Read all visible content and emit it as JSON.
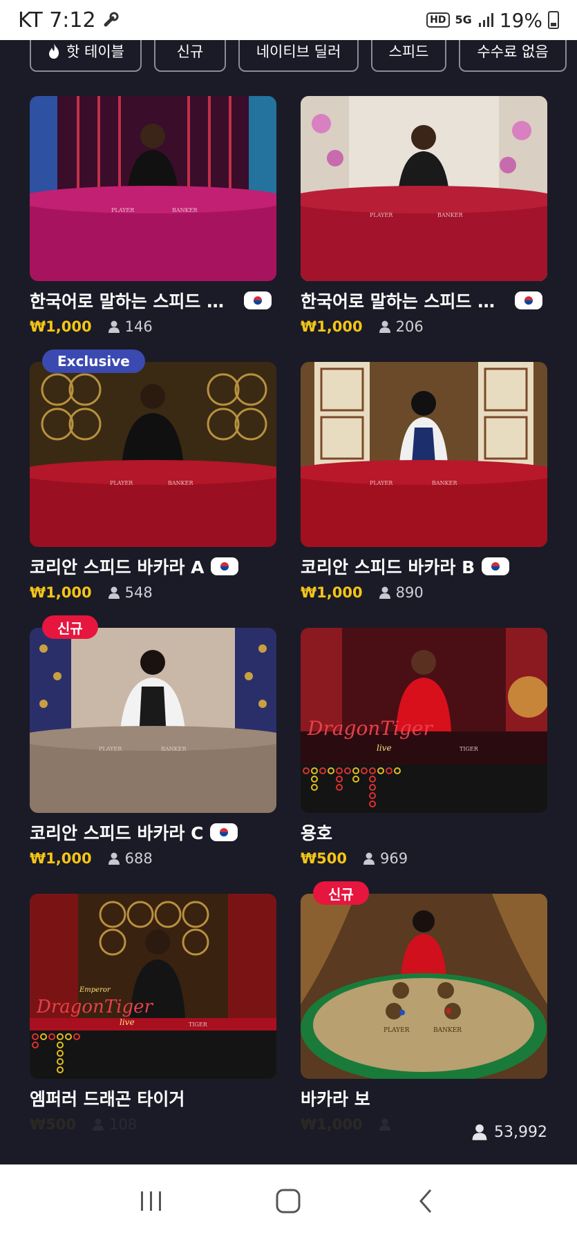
{
  "status": {
    "carrier_time": "KT 7:12",
    "battery": "19%",
    "hd_badge": "HD",
    "network": "5G",
    "icons": [
      "wrench-icon",
      "hd-icon",
      "5g-icon",
      "signal-icon",
      "battery-icon"
    ]
  },
  "filters": [
    {
      "label": "핫 테이블",
      "icon": "flame-icon"
    },
    {
      "label": "신규"
    },
    {
      "label": "네이티브 딜러"
    },
    {
      "label": "스피드"
    },
    {
      "label": "수수료 없음"
    }
  ],
  "games": [
    {
      "title": "한국어로 말하는 스피드 바...",
      "price": "₩1,000",
      "players": "146",
      "flag": "kr-flag",
      "badge": ""
    },
    {
      "title": "한국어로 말하는 스피드 바...",
      "price": "₩1,000",
      "players": "206",
      "flag": "kr-flag",
      "badge": ""
    },
    {
      "title": "코리안 스피드 바카라 A",
      "price": "₩1,000",
      "players": "548",
      "flag": "kr-flag",
      "badge": "Exclusive"
    },
    {
      "title": "코리안 스피드 바카라 B",
      "price": "₩1,000",
      "players": "890",
      "flag": "kr-flag",
      "badge": ""
    },
    {
      "title": "코리안 스피드 바카라 C",
      "price": "₩1,000",
      "players": "688",
      "flag": "kr-flag",
      "badge": "신규"
    },
    {
      "title": "용호",
      "price": "₩500",
      "players": "969",
      "flag": "",
      "badge": ""
    },
    {
      "title": "엠퍼러 드래곤 타이거",
      "price": "₩500",
      "players": "108",
      "flag": "",
      "badge": ""
    },
    {
      "title": "바카라 보",
      "price": "₩1,000",
      "players": "",
      "flag": "",
      "badge": "신규"
    }
  ],
  "thumb_text": {
    "player": "PLAYER",
    "banker": "BANKER",
    "tiger": "TIGER",
    "dragon_tiger_logo": "DragonTiger",
    "emperor": "Emperor",
    "live": "live"
  },
  "total_online": "53,992",
  "colors": {
    "background": "#1a1b26",
    "price": "#f5c518",
    "exclusive_badge": "#3b4ab1",
    "new_badge": "#e6163f",
    "table_red": "#b0102a"
  },
  "nav": [
    "recent-apps-icon",
    "home-icon",
    "back-icon"
  ]
}
